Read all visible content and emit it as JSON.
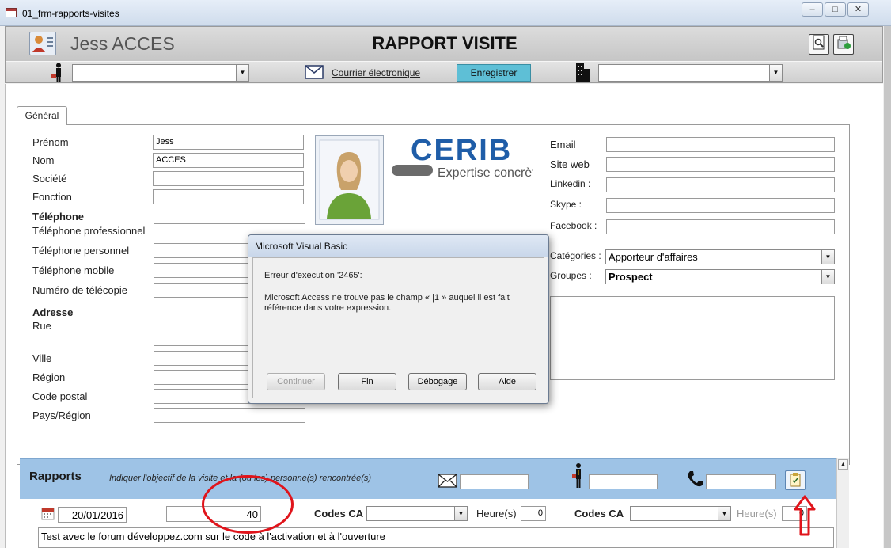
{
  "window": {
    "title": "01_frm-rapports-visites",
    "minimize": "–",
    "restore": "□",
    "close": "✕"
  },
  "header": {
    "user_name": "Jess ACCES",
    "form_title": "RAPPORT VISITE",
    "courrier_label": "Courrier électronique",
    "enregistrer_label": "Enregistrer",
    "contact_combo_value": "",
    "company_combo_value": ""
  },
  "tabs": {
    "general": "Général"
  },
  "fields": {
    "prenom_label": "Prénom",
    "prenom_value": "Jess",
    "nom_label": "Nom",
    "nom_value": "ACCES",
    "societe_label": "Société",
    "societe_value": "",
    "fonction_label": "Fonction",
    "fonction_value": "",
    "telephone_section": "Téléphone",
    "tel_pro_label": "Téléphone professionnel",
    "tel_perso_label": "Téléphone personnel",
    "tel_mobile_label": "Téléphone mobile",
    "telecopie_label": "Numéro de télécopie",
    "adresse_section": "Adresse",
    "rue_label": "Rue",
    "ville_label": "Ville",
    "region_label": "Région",
    "code_postal_label": "Code postal",
    "pays_label": "Pays/Région"
  },
  "logo": {
    "brand": "CERIB",
    "tagline": "Expertise concrète"
  },
  "right_fields": {
    "email_label": "Email",
    "site_web_label": "Site web",
    "linkedin_label": "Linkedin :",
    "skype_label": "Skype :",
    "facebook_label": "Facebook :",
    "categories_label": "Catégories :",
    "categories_value": "Apporteur d'affaires",
    "groupes_label": "Groupes :",
    "groupes_value": "Prospect"
  },
  "dialog": {
    "title": "Microsoft Visual Basic",
    "error": "Erreur d'exécution '2465':",
    "message": "Microsoft Access ne trouve pas le champ « |1 » auquel il est fait référence dans votre expression.",
    "btn_continuer": "Continuer",
    "btn_fin": "Fin",
    "btn_debogage": "Débogage",
    "btn_aide": "Aide"
  },
  "rapports": {
    "title": "Rapports",
    "hint": "Indiquer l'objectif de la visite et la (ou les) personne(s) rencontrée(s)",
    "date": "20/01/2016",
    "number": "40",
    "codes_ca_1": "Codes CA",
    "heures_1": "Heure(s)",
    "heures_1_value": "0",
    "codes_ca_2": "Codes CA",
    "heures_2": "Heure(s)",
    "heures_2_value": "0",
    "comment": "Test avec le forum développez.com sur le code à l'activation et à l'ouverture"
  },
  "colors": {
    "accent_button": "#5ebfd6",
    "rapports_band": "#9ec3e6",
    "annotation": "#e0141b"
  }
}
